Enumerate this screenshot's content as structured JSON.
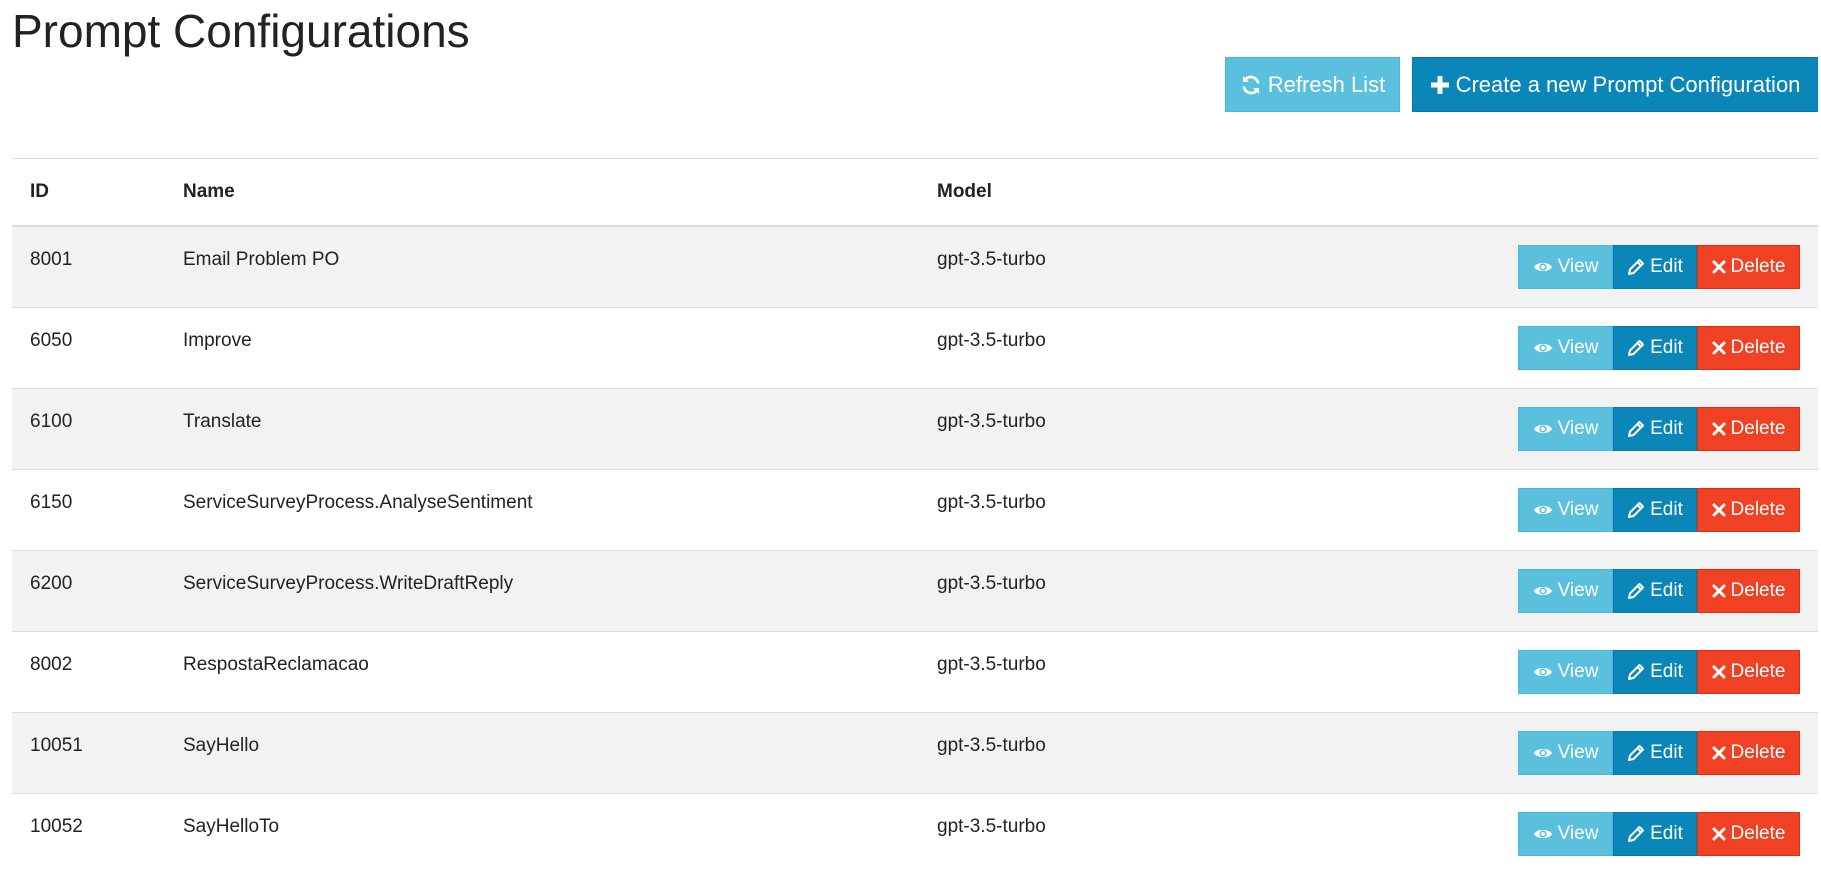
{
  "page": {
    "title": "Prompt Configurations"
  },
  "toolbar": {
    "refresh_label": "Refresh List",
    "create_label": "Create a new Prompt Configuration",
    "refresh_icon": "refresh-icon",
    "create_icon": "plus-icon"
  },
  "table": {
    "headers": {
      "id": "ID",
      "name": "Name",
      "model": "Model"
    },
    "rows": [
      {
        "id": "8001",
        "name": "Email Problem PO",
        "model": "gpt-3.5-turbo"
      },
      {
        "id": "6050",
        "name": "Improve",
        "model": "gpt-3.5-turbo"
      },
      {
        "id": "6100",
        "name": "Translate",
        "model": "gpt-3.5-turbo"
      },
      {
        "id": "6150",
        "name": "ServiceSurveyProcess.AnalyseSentiment",
        "model": "gpt-3.5-turbo"
      },
      {
        "id": "6200",
        "name": "ServiceSurveyProcess.WriteDraftReply",
        "model": "gpt-3.5-turbo"
      },
      {
        "id": "8002",
        "name": "RespostaReclamacao",
        "model": "gpt-3.5-turbo"
      },
      {
        "id": "10051",
        "name": "SayHello",
        "model": "gpt-3.5-turbo"
      },
      {
        "id": "10052",
        "name": "SayHelloTo",
        "model": "gpt-3.5-turbo"
      }
    ],
    "actions": {
      "view_label": "View",
      "edit_label": "Edit",
      "delete_label": "Delete",
      "view_icon": "eye-icon",
      "edit_icon": "pencil-icon",
      "delete_icon": "close-icon"
    }
  },
  "colors": {
    "info": "#5bc0de",
    "primary": "#0a86b8",
    "danger": "#f04124",
    "stripe": "#f2f2f2"
  }
}
